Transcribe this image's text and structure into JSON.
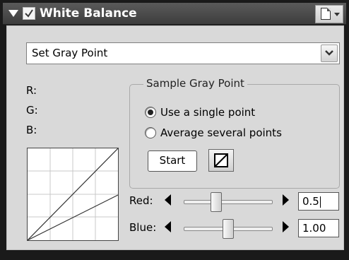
{
  "titlebar": {
    "title": "White Balance",
    "collapse_icon": "triangle-down-icon",
    "enable_checked": true,
    "menu_icon": "document-icon"
  },
  "dropdown": {
    "value": "Set Gray Point"
  },
  "readouts": {
    "r_label": "R:",
    "g_label": "G:",
    "b_label": "B:"
  },
  "sample_group": {
    "title": "Sample Gray Point",
    "options": [
      {
        "label": "Use a single point",
        "selected": true
      },
      {
        "label": "Average several points",
        "selected": false
      }
    ],
    "start_label": "Start",
    "picker_icon": "gray-point-picker-icon"
  },
  "sliders": {
    "red": {
      "label": "Red:",
      "value": "0.5"
    },
    "blue": {
      "label": "Blue:",
      "value": "1.00"
    }
  }
}
